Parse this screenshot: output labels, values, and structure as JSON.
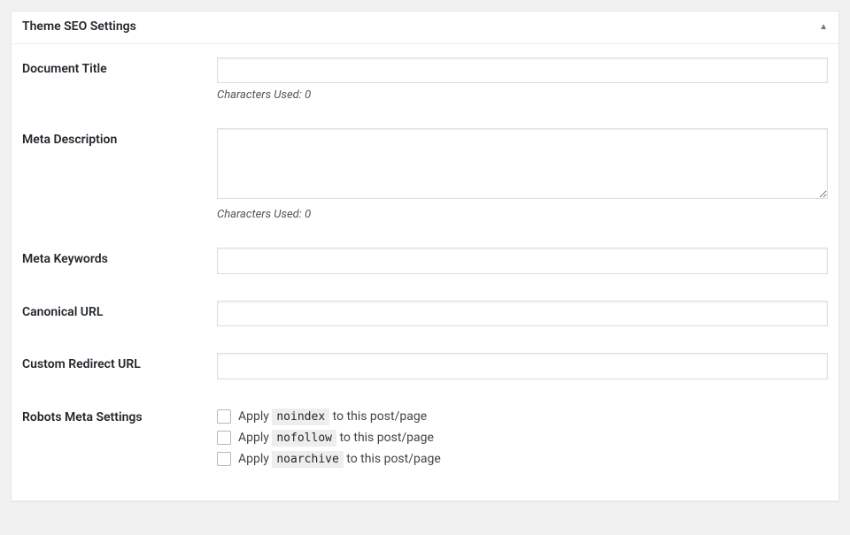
{
  "panel": {
    "title": "Theme SEO Settings"
  },
  "fields": {
    "doc_title": {
      "label": "Document Title",
      "value": "",
      "counter_prefix": "Characters Used: ",
      "counter_value": "0"
    },
    "meta_description": {
      "label": "Meta Description",
      "value": "",
      "counter_prefix": "Characters Used: ",
      "counter_value": "0"
    },
    "meta_keywords": {
      "label": "Meta Keywords",
      "value": ""
    },
    "canonical_url": {
      "label": "Canonical URL",
      "value": ""
    },
    "redirect_url": {
      "label": "Custom Redirect URL",
      "value": ""
    },
    "robots": {
      "label": "Robots Meta Settings",
      "prefix": "Apply ",
      "suffix": " to this post/page",
      "options": {
        "noindex": "noindex",
        "nofollow": "nofollow",
        "noarchive": "noarchive"
      }
    }
  }
}
